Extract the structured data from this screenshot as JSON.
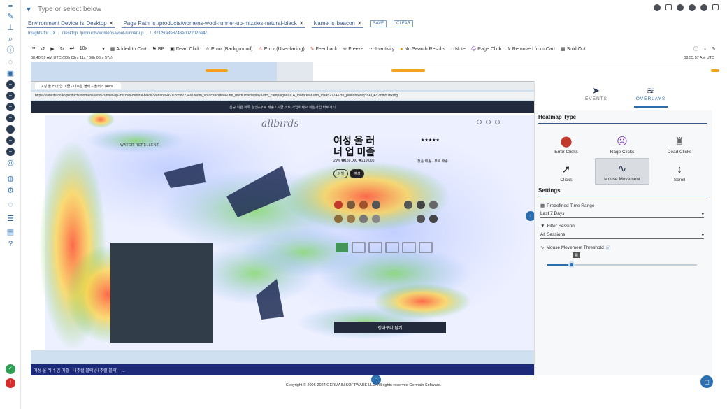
{
  "search": {
    "placeholder": "Type or select below"
  },
  "filters": [
    {
      "label": "Environment Device",
      "op": "is",
      "value": "Desktop"
    },
    {
      "label": "Page Path",
      "op": "is",
      "value": "/products/womens-wool-runner-up-mizzles-natural-black"
    },
    {
      "label": "Name",
      "op": "is",
      "value": "beacon"
    }
  ],
  "filter_actions": {
    "save": "SAVE",
    "clear": "CLEAR"
  },
  "breadcrumb": {
    "root": "Insights for UX",
    "page": "Desktop: /products/womens-wool-runner-up...",
    "session": "871f50efe8743e002202be4c"
  },
  "toolbar": {
    "zoom": "10x",
    "items": [
      "Added to Cart",
      "BP",
      "Dead Click",
      "Error (Background)",
      "Error (User-facing)",
      "Feedback",
      "Freeze",
      "Inactivity",
      "No Search Results",
      "Note",
      "Rage Click",
      "Removed from Cart",
      "Sold Out"
    ]
  },
  "timeline": {
    "start": "08:40:59 AM UTC (00h 02m 11s / 00h 06m 57s)",
    "end": "08:55:57 AM UTC"
  },
  "browser": {
    "tab_title": "여성 울 러너 업 미즐 - 내추럴 블랙 – 올버즈 (Allbi...",
    "url": "https://allbirds.co.kr/products/womens-wool-runner-up-mizzles-natural-black?variant=46002858223461&utm_source=criteo&utm_medium=display&utm_campaign=CCA_InMarket&utm_id=452774&cto_pld=obIwwqYoAQAYZnm5Thkr8g"
  },
  "site": {
    "promo": "신규 회원 하루 할인&무료 배송 / 지금 바로 가입하세요  회원가입 바로가기",
    "logo": "allbirds",
    "badge": "WATER REPELLENT",
    "title": "여성 울 러너 업 미즐",
    "rating": "★★★★★",
    "price": "29% ₩159,000 ₩219,000",
    "shipping": "정품 배송 · 무료 배송",
    "toggle": [
      "성별",
      "여성"
    ],
    "cta": "장바구니 담기"
  },
  "bottom_tab": "여성 울 러너 업 미즐 - 내추럴 블랙 (내추럴 블랙) - ...",
  "panel": {
    "tabs": [
      {
        "label": "EVENTS"
      },
      {
        "label": "OVERLAYS"
      }
    ],
    "heatmap_type": "Heatmap Type",
    "heatmap_items": [
      "Error Clicks",
      "Rage Clicks",
      "Dead Clicks",
      "Clicks",
      "Mouse Movement",
      "Scroll"
    ],
    "settings": "Settings",
    "time_range": {
      "label": "Predefined Time Range",
      "value": "Last 7 Days"
    },
    "filter_session": {
      "label": "Filter Session",
      "value": "All Sessions"
    },
    "threshold": {
      "label": "Mouse Movement Threshold",
      "value": 0.16
    }
  },
  "footer": "Copyright © 2006-2024 GERMAIN SOFTWARE LLC. All rights reserved Germain Software.",
  "colors": {
    "accent": "#2b6fb0",
    "nav_dark": "#212b3d"
  }
}
